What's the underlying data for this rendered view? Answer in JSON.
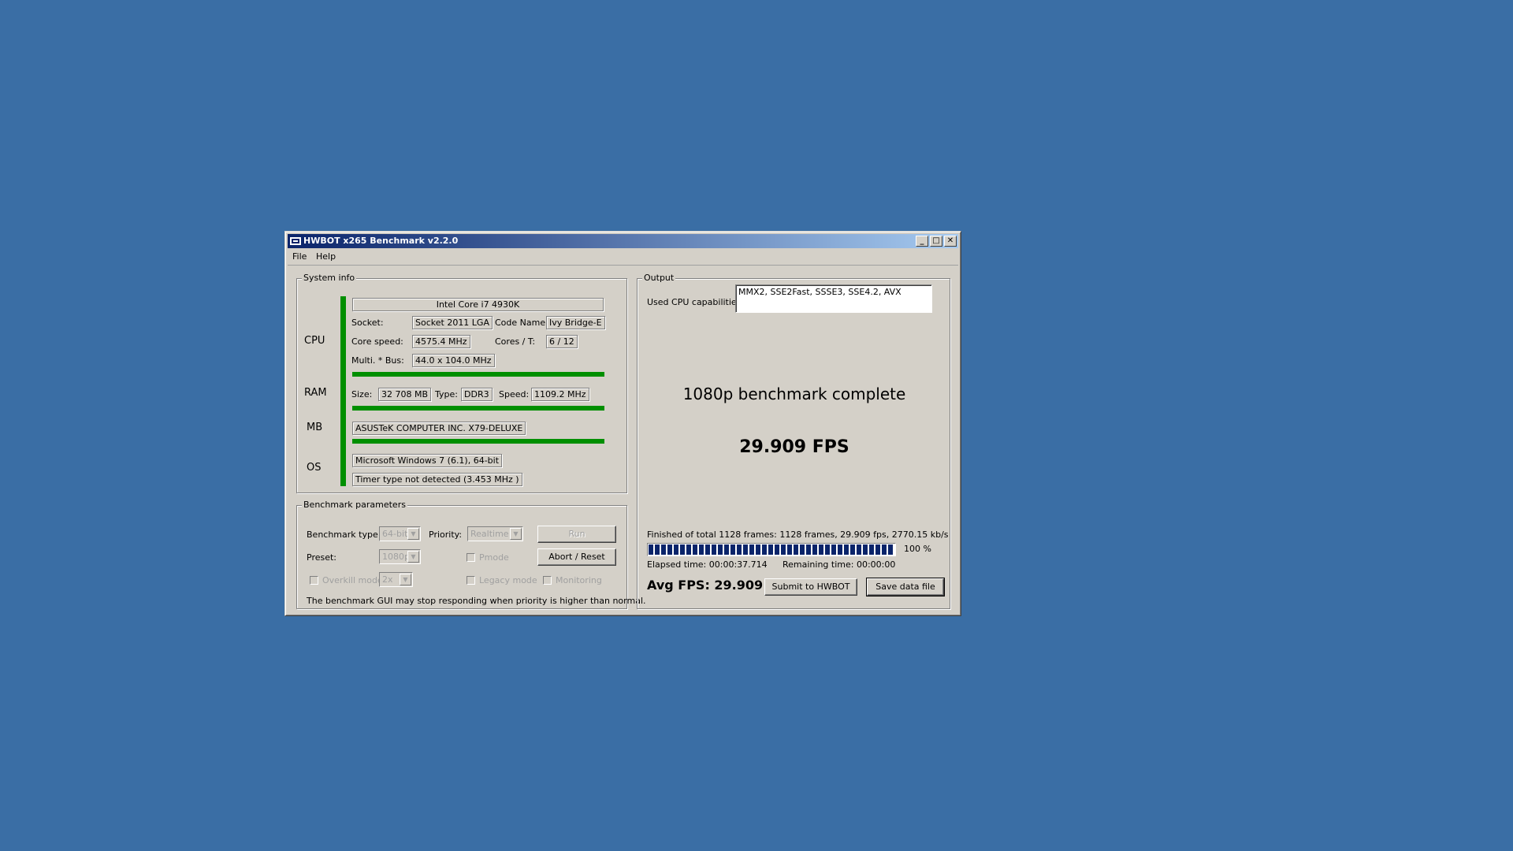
{
  "window": {
    "title": "HWBOT x265 Benchmark v2.2.0",
    "minimize_label": "_",
    "maximize_label": "□",
    "close_label": "✕"
  },
  "menu": {
    "file": "File",
    "help": "Help"
  },
  "system_info": {
    "legend": "System info",
    "cpu_label": "CPU",
    "ram_label": "RAM",
    "mb_label": "MB",
    "os_label": "OS",
    "cpu_name": "Intel Core i7 4930K",
    "socket_label": "Socket:",
    "socket": "Socket 2011 LGA",
    "codename_label": "Code Name:",
    "codename": "Ivy Bridge-E",
    "core_speed_label": "Core speed:",
    "core_speed": "4575.4 MHz",
    "cores_label": "Cores / T:",
    "cores": "6 / 12",
    "multi_bus_label": "Multi. * Bus:",
    "multi_bus": "44.0 x 104.0 MHz",
    "ram_size_label": "Size:",
    "ram_size": "32 708 MB",
    "ram_type_label": "Type:",
    "ram_type": "DDR3",
    "ram_speed_label": "Speed:",
    "ram_speed": "1109.2 MHz",
    "mb_name": "ASUSTeK COMPUTER INC. X79-DELUXE",
    "os_name": "Microsoft Windows 7 (6.1), 64-bit",
    "timer": "Timer type not detected (3.453 MHz )"
  },
  "benchmark_params": {
    "legend": "Benchmark parameters",
    "type_label": "Benchmark type:",
    "type_value": "64-bit",
    "priority_label": "Priority:",
    "priority_value": "Realtime",
    "run_label": "Run",
    "preset_label": "Preset:",
    "preset_value": "1080p",
    "pmode_label": "Pmode",
    "abort_label": "Abort / Reset",
    "overkill_label": "Overkill mode",
    "overkill_value": "2x",
    "legacy_label": "Legacy mode",
    "monitoring_label": "Monitoring",
    "warning": "The benchmark GUI may stop responding when priority is higher than normal."
  },
  "output": {
    "legend": "Output",
    "cpu_caps_label": "Used CPU capabilities:",
    "cpu_caps": "MMX2, SSE2Fast, SSSE3, SSE4.2, AVX",
    "status": "1080p benchmark complete",
    "fps_result": "29.909 FPS",
    "frames_info": "Finished of total 1128 frames: 1128 frames, 29.909 fps,  2770.15 kb/s",
    "progress_percent_label": "100 %",
    "progress_fraction": 1.0,
    "elapsed": "Elapsed time: 00:00:37.714",
    "remaining": "Remaining time: 00:00:00",
    "avg_fps": "Avg FPS: 29.909",
    "submit_label": "Submit to HWBOT",
    "save_label": "Save data file"
  },
  "colors": {
    "desktop": "#3a6ea5",
    "titlebar_start": "#0a246a",
    "titlebar_end": "#a6caf0",
    "status_bar_green": "#008f00",
    "progress_fill": "#0a246a"
  }
}
